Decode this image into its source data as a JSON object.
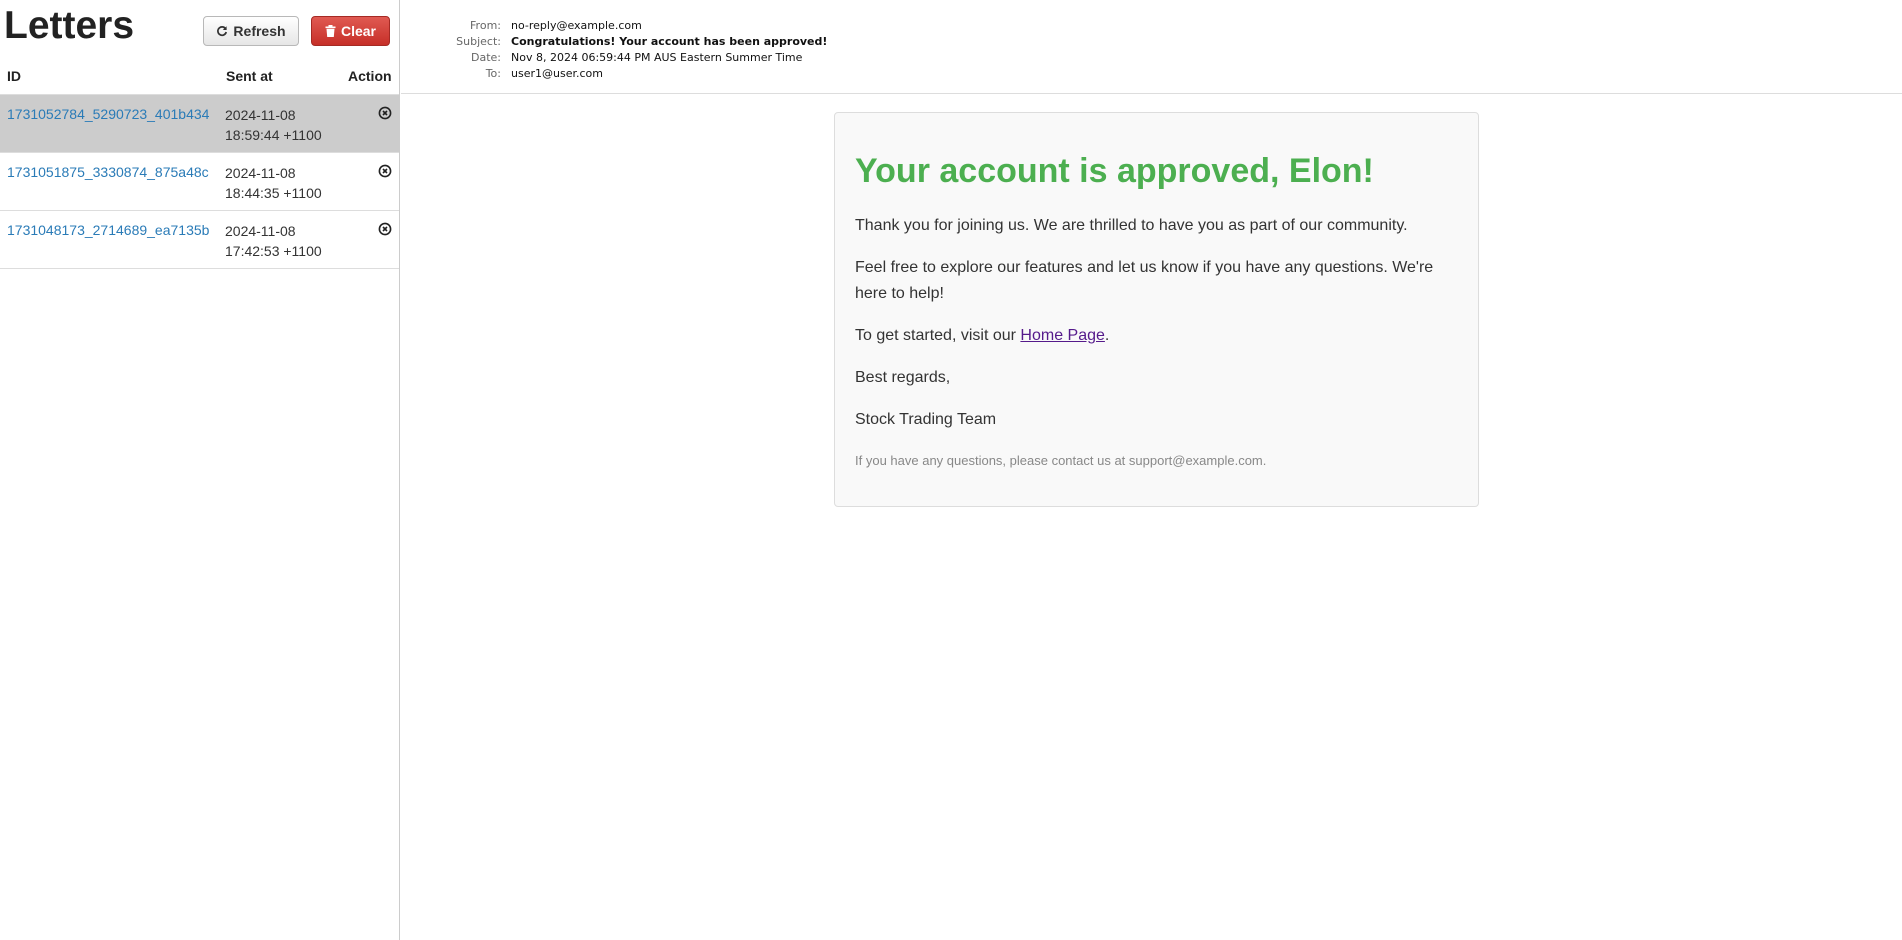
{
  "sidebar": {
    "title": "Letters",
    "refresh_label": "Refresh",
    "clear_label": "Clear",
    "columns": {
      "id": "ID",
      "sent": "Sent at",
      "action": "Action"
    },
    "letters": [
      {
        "id": "1731052784_5290723_401b434",
        "date": "2024-11-08",
        "time": "18:59:44 +1100",
        "selected": true
      },
      {
        "id": "1731051875_3330874_875a48c",
        "date": "2024-11-08",
        "time": "18:44:35 +1100",
        "selected": false
      },
      {
        "id": "1731048173_2714689_ea7135b",
        "date": "2024-11-08",
        "time": "17:42:53 +1100",
        "selected": false
      }
    ]
  },
  "message": {
    "headers": {
      "from_label": "From:",
      "from": "no-reply@example.com",
      "subject_label": "Subject:",
      "subject": "Congratulations! Your account has been approved!",
      "date_label": "Date:",
      "date": "Nov 8, 2024 06:59:44 PM AUS Eastern Summer Time",
      "to_label": "To:",
      "to": "user1@user.com"
    },
    "body": {
      "heading": "Your account is approved, Elon!",
      "p1": "Thank you for joining us. We are thrilled to have you as part of our community.",
      "p2": "Feel free to explore our features and let us know if you have any questions. We're here to help!",
      "p3_before": "To get started, visit our ",
      "p3_link": "Home Page",
      "p3_after": ".",
      "p4": "Best regards,",
      "p5": "Stock Trading Team",
      "footer": "If you have any questions, please contact us at support@example.com."
    }
  },
  "colors": {
    "accent_green": "#4caf50",
    "link_blue": "#2a7bb7",
    "clear_red": "#d9534f",
    "selected_row": "#cccccc"
  },
  "icons": {
    "refresh": "refresh-icon",
    "clear": "trash-icon",
    "delete": "close-circle-icon"
  }
}
